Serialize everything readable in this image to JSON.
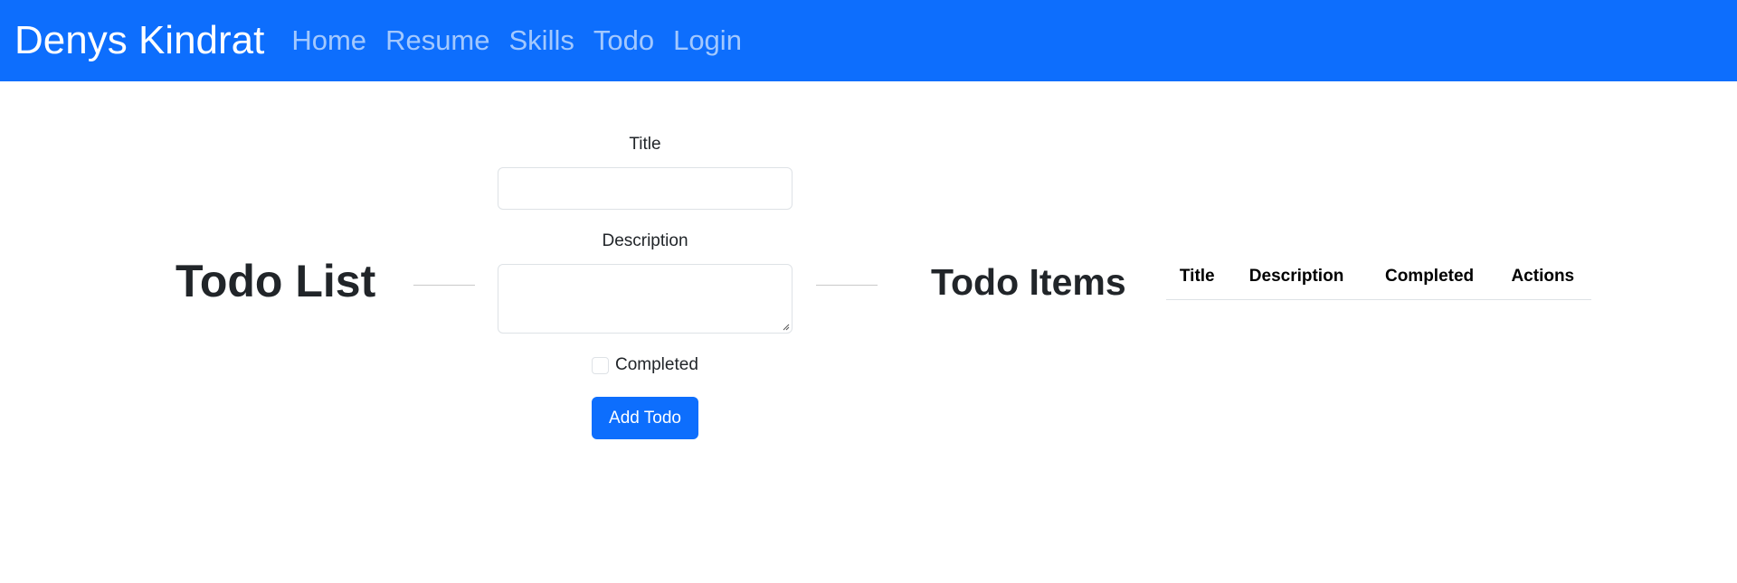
{
  "navbar": {
    "brand": "Denys Kindrat",
    "links": [
      "Home",
      "Resume",
      "Skills",
      "Todo",
      "Login"
    ],
    "background_color": "#0d6efd"
  },
  "page": {
    "left_heading": "Todo List",
    "right_heading": "Todo Items"
  },
  "form": {
    "title_label": "Title",
    "title_value": "",
    "description_label": "Description",
    "description_value": "",
    "completed_label": "Completed",
    "completed_checked": false,
    "submit_label": "Add Todo",
    "button_color": "#0d6efd"
  },
  "table": {
    "columns": [
      "Title",
      "Description",
      "Completed",
      "Actions"
    ],
    "rows": []
  }
}
